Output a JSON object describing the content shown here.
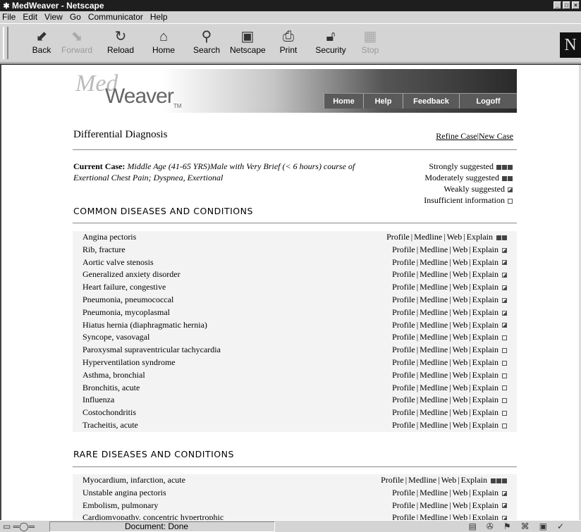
{
  "window": {
    "title": "MedWeaver - Netscape",
    "title_icon": "asterisk-icon"
  },
  "menu": [
    "File",
    "Edit",
    "View",
    "Go",
    "Communicator",
    "Help"
  ],
  "toolbar": {
    "buttons": [
      {
        "label": "Back",
        "icon": "back-arrow-icon"
      },
      {
        "label": "Forward",
        "icon": "forward-arrow-icon"
      },
      {
        "label": "Reload",
        "icon": "reload-icon"
      },
      {
        "label": "Home",
        "icon": "home-icon"
      },
      {
        "label": "Search",
        "icon": "search-icon"
      },
      {
        "label": "Netscape",
        "icon": "netscape-icon"
      },
      {
        "label": "Print",
        "icon": "print-icon"
      },
      {
        "label": "Security",
        "icon": "lock-icon"
      },
      {
        "label": "Stop",
        "icon": "stop-icon"
      }
    ],
    "logo": "N"
  },
  "banner": {
    "logo_top": "Med",
    "logo_bottom": "Weaver",
    "trademark": "TM",
    "nav": [
      "Home",
      "Help",
      "Feedback",
      "Logoff"
    ]
  },
  "page": {
    "title": "Differential Diagnosis",
    "refine_link": "Refine Case",
    "separator": "|",
    "new_case_link": "New Case"
  },
  "current_case": {
    "label": "Current Case:",
    "text": "Middle Age (41-65 YRS)Male with Very Brief (< 6 hours) course of Exertional Chest Pain; Dyspnea, Exertional"
  },
  "legend": [
    {
      "label": "Strongly suggested",
      "level": "strong"
    },
    {
      "label": "Moderately suggested",
      "level": "moderate"
    },
    {
      "label": "Weakly suggested",
      "level": "weak"
    },
    {
      "label": "Insufficient information",
      "level": "none"
    }
  ],
  "link_labels": [
    "Profile",
    "Medline",
    "Web",
    "Explain"
  ],
  "sections": {
    "common": {
      "heading": "COMMON DISEASES AND CONDITIONS",
      "rows": [
        {
          "name": "Angina pectoris",
          "level": "moderate"
        },
        {
          "name": "Rib, fracture",
          "level": "weak"
        },
        {
          "name": "Aortic valve stenosis",
          "level": "weak"
        },
        {
          "name": "Generalized anxiety disorder",
          "level": "weak"
        },
        {
          "name": "Heart failure, congestive",
          "level": "weak"
        },
        {
          "name": "Pneumonia, pneumococcal",
          "level": "weak"
        },
        {
          "name": "Pneumonia, mycoplasmal",
          "level": "weak"
        },
        {
          "name": "Hiatus hernia (diaphragmatic hernia)",
          "level": "weak"
        },
        {
          "name": "Syncope, vasovagal",
          "level": "none"
        },
        {
          "name": "Paroxysmal supraventricular tachycardia",
          "level": "none"
        },
        {
          "name": "Hyperventilation syndrome",
          "level": "none"
        },
        {
          "name": "Asthma, bronchial",
          "level": "none"
        },
        {
          "name": "Bronchitis, acute",
          "level": "none"
        },
        {
          "name": "Influenza",
          "level": "none"
        },
        {
          "name": "Costochondritis",
          "level": "none"
        },
        {
          "name": "Tracheitis, acute",
          "level": "none"
        }
      ]
    },
    "rare": {
      "heading": "RARE DISEASES AND CONDITIONS",
      "rows": [
        {
          "name": "Myocardium, infarction, acute",
          "level": "strong"
        },
        {
          "name": "Unstable angina pectoris",
          "level": "weak"
        },
        {
          "name": "Embolism, pulmonary",
          "level": "weak"
        },
        {
          "name": "Cardiomyopathy, concentric hypertrophic",
          "level": "weak"
        }
      ]
    }
  },
  "status": {
    "text": "Document: Done"
  }
}
